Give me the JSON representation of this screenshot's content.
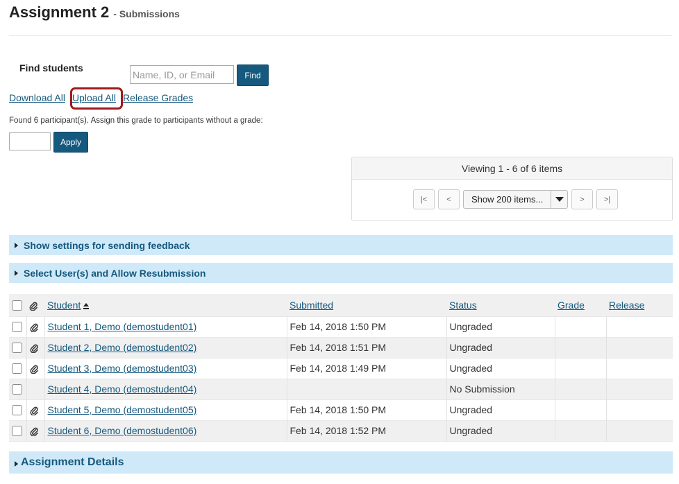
{
  "header": {
    "title": "Assignment 2",
    "subtitle": "- Submissions"
  },
  "search": {
    "label": "Find students",
    "placeholder": "Name, ID, or Email",
    "button_label": "Find"
  },
  "actions": {
    "download_all": "Download All",
    "upload_all": "Upload All",
    "release_grades": "Release Grades"
  },
  "grade_assign": {
    "text": "Found 6 participant(s). Assign this grade to participants without a grade:",
    "value": "",
    "apply_label": "Apply"
  },
  "pager": {
    "viewing": "Viewing 1 - 6 of 6 items",
    "first": "|<",
    "prev": "<",
    "next": ">",
    "last": ">|",
    "page_size": "Show 200 items..."
  },
  "sections": {
    "feedback": "Show settings for sending feedback",
    "resubmission": "Select User(s) and Allow Resubmission",
    "details": "Assignment Details"
  },
  "table": {
    "headers": {
      "student": "Student",
      "submitted": "Submitted",
      "status": "Status",
      "grade": "Grade",
      "release": "Release"
    },
    "rows": [
      {
        "student": "Student 1, Demo (demostudent01)",
        "submitted": "Feb 14, 2018 1:50 PM",
        "status": "Ungraded",
        "grade": "",
        "release": "",
        "attachment": true
      },
      {
        "student": "Student 2, Demo (demostudent02)",
        "submitted": "Feb 14, 2018 1:51 PM",
        "status": "Ungraded",
        "grade": "",
        "release": "",
        "attachment": true
      },
      {
        "student": "Student 3, Demo (demostudent03)",
        "submitted": "Feb 14, 2018 1:49 PM",
        "status": "Ungraded",
        "grade": "",
        "release": "",
        "attachment": true
      },
      {
        "student": "Student 4, Demo (demostudent04)",
        "submitted": "",
        "status": "No Submission",
        "grade": "",
        "release": "",
        "attachment": false
      },
      {
        "student": "Student 5, Demo (demostudent05)",
        "submitted": "Feb 14, 2018 1:50 PM",
        "status": "Ungraded",
        "grade": "",
        "release": "",
        "attachment": true
      },
      {
        "student": "Student 6, Demo (demostudent06)",
        "submitted": "Feb 14, 2018 1:52 PM",
        "status": "Ungraded",
        "grade": "",
        "release": "",
        "attachment": true
      }
    ]
  },
  "colors": {
    "link": "#15597e",
    "button": "#15597e",
    "section_bar": "#cfe9f9",
    "highlight": "#9e1a1a"
  },
  "icons": {
    "attachment": "paperclip-icon",
    "sort": "sort-ascending-icon",
    "expand": "caret-right-icon"
  }
}
